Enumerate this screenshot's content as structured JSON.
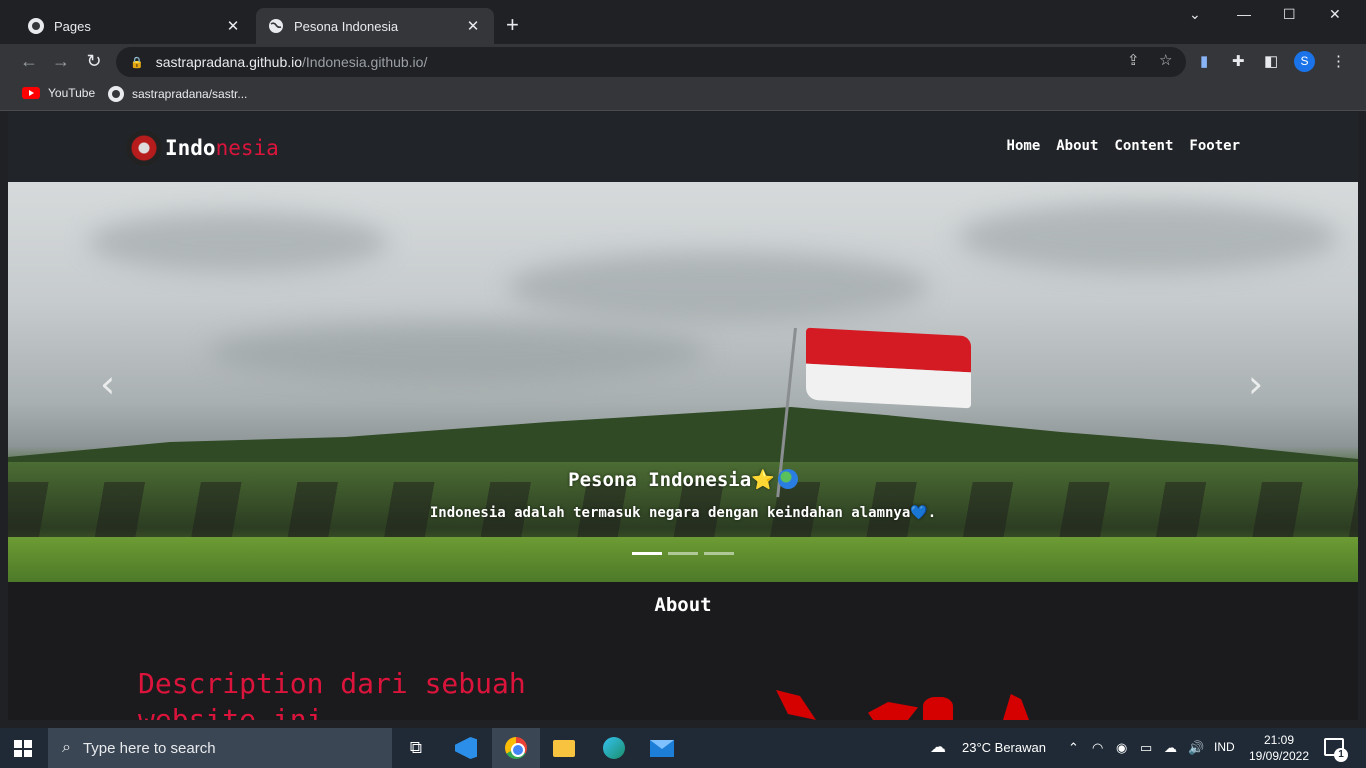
{
  "browser": {
    "tabs": [
      {
        "title": "Pages",
        "icon": "github-icon"
      },
      {
        "title": "Pesona Indonesia",
        "icon": "globe-icon"
      }
    ],
    "tab_close": "✕",
    "new_tab": "+",
    "url_host": "sastrapradana.github.io",
    "url_path": "/Indonesia.github.io/",
    "profile_initial": "S",
    "bookmarks": [
      {
        "label": "YouTube",
        "icon": "youtube-icon"
      },
      {
        "label": "sastrapradana/sastr...",
        "icon": "github-icon"
      }
    ]
  },
  "site": {
    "brand_white": "Indo",
    "brand_red": "nesia",
    "nav": [
      "Home",
      "About",
      "Content",
      "Footer"
    ],
    "carousel": {
      "title": "Pesona Indonesia",
      "title_star": "⭐",
      "text": "Indonesia adalah termasuk negara dengan keindahan alamnya",
      "text_heart": "💙",
      "text_end": ".",
      "prev": "‹",
      "next": "›",
      "slides": 3,
      "active_slide": 1
    },
    "about_title": "About",
    "description_line1": "Description dari sebuah",
    "description_line2": "website ini"
  },
  "taskbar": {
    "search_placeholder": "Type here to search",
    "weather": "23°C  Berawan",
    "language": "IND",
    "time": "21:09",
    "date": "19/09/2022",
    "notifications": "1"
  },
  "colors": {
    "accent_red": "#dc143c",
    "nav_bg": "#212529",
    "chrome_bg": "#202124"
  }
}
